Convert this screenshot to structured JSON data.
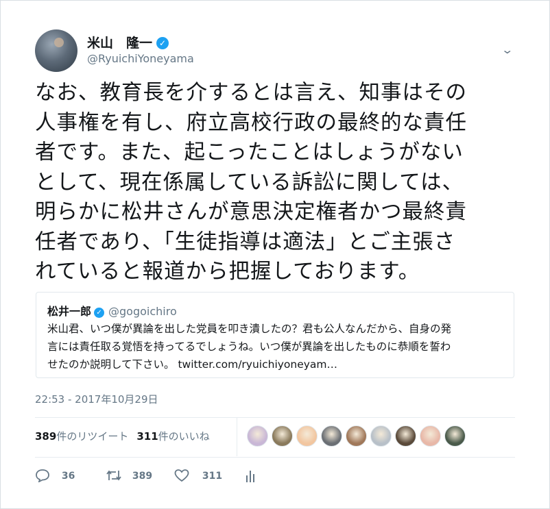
{
  "author": {
    "name": "米山　隆一",
    "handle": "@RyuichiYoneyama",
    "verified": true
  },
  "tweet_lines": [
    "なお、教育長を介するとは言え、知事はその",
    "人事権を有し、府立高校行政の最終的な責任",
    "者です。また、起こったことはしょうがない",
    "として、現在係属している訴訟に関しては、",
    "明らかに松井さんが意思決定権者かつ最終責",
    "任者であり、「生徒指導は適法」とご主張さ",
    "れていると報道から把握しております。"
  ],
  "quoted": {
    "name": "松井一郎",
    "handle": "@gogoichiro",
    "lines": [
      "米山君、いつ僕が異論を出した党員を叩き潰したの？君も公人なんだから、自身の発",
      "言には責任取る覚悟を持ってるでしょうね。いつ僕が異論を出したものに恭順を誓わ",
      "せたのか説明して下さい。 twitter.com/ryuichiyoneyam…"
    ]
  },
  "timestamp": "22:53 - 2017年10月29日",
  "stats": {
    "retweet_count": "389",
    "retweet_label": "件のリツイート",
    "like_count": "311",
    "like_label": "件のいいね"
  },
  "actions": {
    "reply_count": "36",
    "retweet_count": "389",
    "like_count": "311"
  },
  "icons": {
    "reply": "reply-icon",
    "retweet": "retweet-icon",
    "like": "heart-icon",
    "analytics": "analytics-icon",
    "more": "chevron-down-icon",
    "verified": "verified-badge-icon"
  },
  "colors": {
    "verified_blue": "#1da1f2",
    "secondary_text": "#657786",
    "primary_text": "#14171a"
  },
  "liker_avatar_colors": [
    "#c9b7d6",
    "#8a7a5c",
    "#f2c6a0",
    "#6b6f74",
    "#a0785a",
    "#b8c0c8",
    "#5a4a3a",
    "#e8b8a8",
    "#4a5a4a"
  ]
}
